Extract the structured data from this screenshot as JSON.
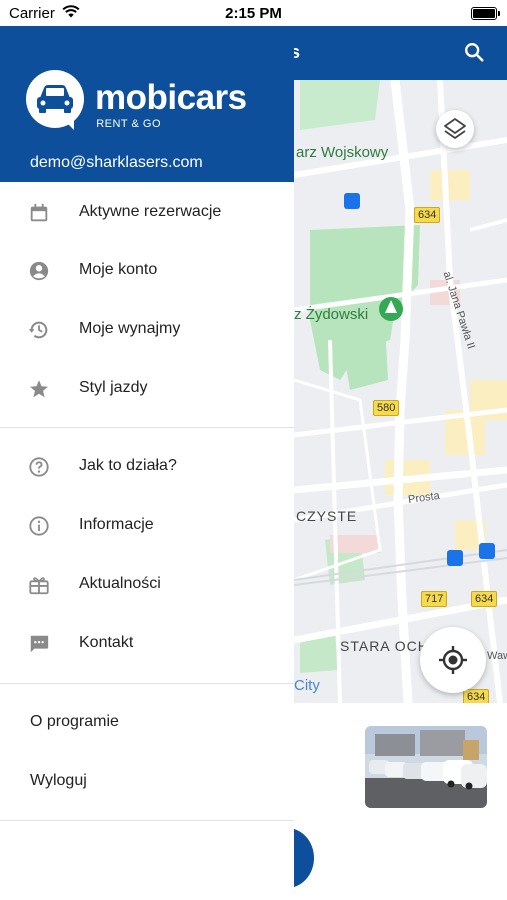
{
  "status_bar": {
    "carrier": "Carrier",
    "time": "2:15 PM",
    "battery_level": 0.9
  },
  "app_header": {
    "title_fragment": "s",
    "search_icon": "search-icon"
  },
  "map": {
    "labels": {
      "cemetery_military": "arz Wojskowy",
      "cemetery_jewish": "z Żydowski",
      "district_czyste": "CZYSTE",
      "district_stara_ochota": "STARA OCH",
      "street_jana_pawla": "al. Jana Pawła II",
      "street_prosta": "Prosta",
      "city_fragment": "City",
      "street_waw": "Waw"
    },
    "road_shields": {
      "r634_top": "634",
      "r580": "580",
      "r717": "717",
      "r634_mid": "634",
      "r634_bottom": "634"
    }
  },
  "drawer": {
    "brand": "mobicars",
    "tagline": "RENT & GO",
    "email": "demo@sharklasers.com",
    "primary_items": [
      {
        "label": "Aktywne rezerwacje",
        "icon": "calendar-icon"
      },
      {
        "label": "Moje konto",
        "icon": "account-icon"
      },
      {
        "label": "Moje wynajmy",
        "icon": "history-icon"
      },
      {
        "label": "Styl jazdy",
        "icon": "star-icon"
      }
    ],
    "secondary_items": [
      {
        "label": "Jak to działa?",
        "icon": "help-icon"
      },
      {
        "label": "Informacje",
        "icon": "info-icon"
      },
      {
        "label": "Aktualności",
        "icon": "gift-icon"
      },
      {
        "label": "Kontakt",
        "icon": "chat-icon"
      }
    ],
    "footer_items": [
      {
        "label": "O programie"
      },
      {
        "label": "Wyloguj"
      }
    ]
  },
  "colors": {
    "brand_blue": "#0d4f9a",
    "icon_gray": "#8a8a8a",
    "park_green": "#b7e4bd"
  }
}
